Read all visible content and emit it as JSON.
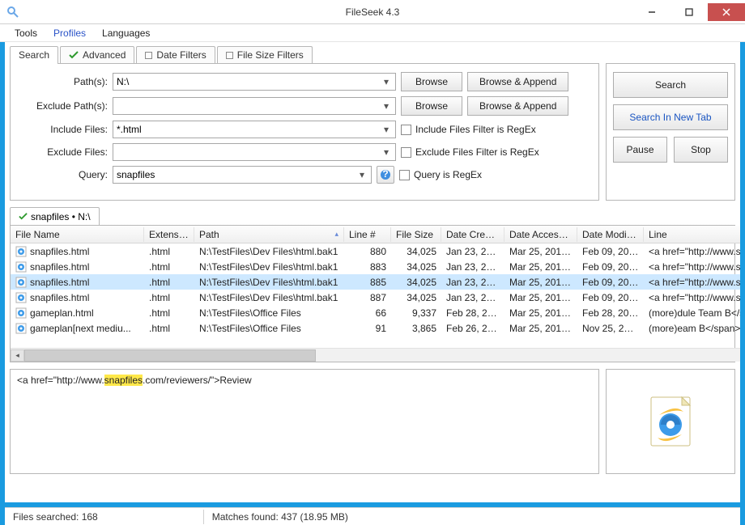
{
  "window": {
    "title": "FileSeek 4.3"
  },
  "menu": {
    "tools": "Tools",
    "profiles": "Profiles",
    "languages": "Languages"
  },
  "tabs": {
    "search": "Search",
    "advanced": "Advanced",
    "date_filters": "Date Filters",
    "size_filters": "File Size Filters"
  },
  "form": {
    "paths_label": "Path(s):",
    "paths_value": "N:\\",
    "exclude_paths_label": "Exclude Path(s):",
    "exclude_paths_value": "",
    "include_files_label": "Include Files:",
    "include_files_value": "*.html",
    "exclude_files_label": "Exclude Files:",
    "exclude_files_value": "",
    "query_label": "Query:",
    "query_value": "snapfiles",
    "browse": "Browse",
    "browse_append": "Browse & Append",
    "include_regex": "Include Files Filter is RegEx",
    "exclude_regex": "Exclude Files Filter is RegEx",
    "query_regex": "Query is RegEx"
  },
  "side": {
    "search": "Search",
    "search_new_tab": "Search In New Tab",
    "pause": "Pause",
    "stop": "Stop"
  },
  "results_tab": "snapfiles • N:\\",
  "columns": {
    "filename": "File Name",
    "ext": "Extension",
    "path": "Path",
    "lineno": "Line #",
    "filesize": "File Size",
    "created": "Date Created",
    "accessed": "Date Accessed",
    "modified": "Date Modified",
    "line": "Line"
  },
  "rows": [
    {
      "fn": "snapfiles.html",
      "ext": ".html",
      "path": "N:\\TestFiles\\Dev Files\\html.bak1",
      "ln": "880",
      "fs": "34,025",
      "dc": "Jan 23, 20...",
      "da": "Mar 25, 2015...",
      "dm": "Feb 09, 200...",
      "line": "<a href=\"http://www.sn"
    },
    {
      "fn": "snapfiles.html",
      "ext": ".html",
      "path": "N:\\TestFiles\\Dev Files\\html.bak1",
      "ln": "883",
      "fs": "34,025",
      "dc": "Jan 23, 20...",
      "da": "Mar 25, 2015...",
      "dm": "Feb 09, 200...",
      "line": "<a href=\"http://www.sn"
    },
    {
      "fn": "snapfiles.html",
      "ext": ".html",
      "path": "N:\\TestFiles\\Dev Files\\html.bak1",
      "ln": "885",
      "fs": "34,025",
      "dc": "Jan 23, 20...",
      "da": "Mar 25, 2015...",
      "dm": "Feb 09, 200...",
      "line": "<a href=\"http://www.sn",
      "sel": true
    },
    {
      "fn": "snapfiles.html",
      "ext": ".html",
      "path": "N:\\TestFiles\\Dev Files\\html.bak1",
      "ln": "887",
      "fs": "34,025",
      "dc": "Jan 23, 20...",
      "da": "Mar 25, 2015...",
      "dm": "Feb 09, 200...",
      "line": "<a href=\"http://www.sn"
    },
    {
      "fn": "gameplan.html",
      "ext": ".html",
      "path": "N:\\TestFiles\\Office Files",
      "ln": "66",
      "fs": "9,337",
      "dc": "Feb 28, 20...",
      "da": "Mar 25, 2015...",
      "dm": "Feb 28, 201...",
      "line": "(more)dule Team B</sp"
    },
    {
      "fn": "gameplan[next mediu...",
      "ext": ".html",
      "path": "N:\\TestFiles\\Office Files",
      "ln": "91",
      "fs": "3,865",
      "dc": "Feb 26, 20...",
      "da": "Mar 25, 2015...",
      "dm": "Nov 25, 201...",
      "line": "(more)eam B</span></"
    }
  ],
  "preview": {
    "pre": "<a href=\"http://www.",
    "hl": "snapfiles",
    "post": ".com/reviewers/\">Review"
  },
  "status": {
    "searched": "Files searched: 168",
    "matches": "Matches found: 437 (18.95 MB)"
  }
}
